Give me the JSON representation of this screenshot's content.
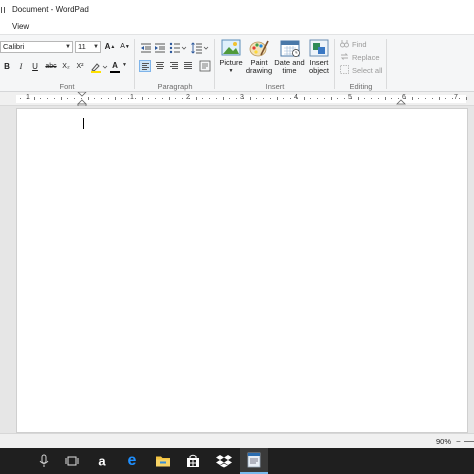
{
  "window": {
    "title": "Document - WordPad"
  },
  "menu": {
    "tabs": [
      {
        "label": "View"
      }
    ]
  },
  "ribbon": {
    "font": {
      "group_label": "Font",
      "family": "Calibri",
      "size": "11",
      "bold": "B",
      "italic": "I",
      "underline": "U",
      "strikethrough": "abc",
      "subscript": "X₂",
      "superscript": "X²",
      "grow": "A",
      "shrink": "A",
      "color_letter": "A"
    },
    "paragraph": {
      "group_label": "Paragraph"
    },
    "insert": {
      "group_label": "Insert",
      "picture": "Picture",
      "paint_drawing_1": "Paint",
      "paint_drawing_2": "drawing",
      "date_time_1": "Date and",
      "date_time_2": "time",
      "insert_object_1": "Insert",
      "insert_object_2": "object"
    },
    "editing": {
      "group_label": "Editing",
      "find": "Find",
      "replace": "Replace",
      "select_all": "Select all"
    }
  },
  "ruler": {
    "numbers": [
      "1",
      "1",
      "2",
      "3",
      "4",
      "5",
      "6",
      "7"
    ]
  },
  "status": {
    "zoom": "90%",
    "zoom_minus": "−"
  },
  "colors": {
    "accent": "#2b579a",
    "taskbar": "#1f1f1f",
    "active_underline": "#76b9ed"
  },
  "taskbar": {
    "icons": [
      "microphone-icon",
      "task-view-icon",
      "amazon-icon",
      "edge-icon",
      "file-explorer-icon",
      "store-icon",
      "dropbox-icon",
      "wordpad-icon"
    ],
    "amazon_letter": "a",
    "edge_letter": "e"
  }
}
